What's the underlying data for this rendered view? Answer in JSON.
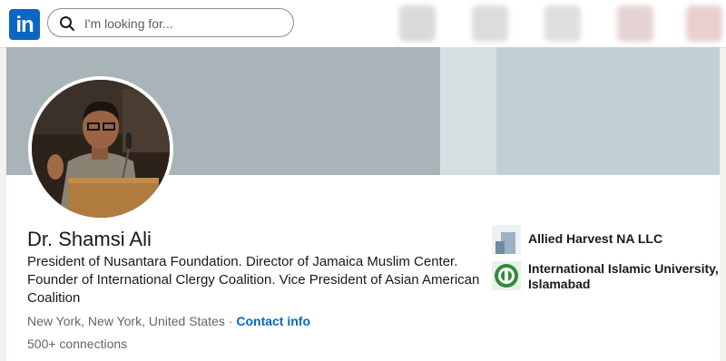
{
  "header": {
    "logo_text": "in",
    "search_placeholder": "I'm looking for..."
  },
  "profile": {
    "name": "Dr. Shamsi Ali",
    "headline": "President of Nusantara Foundation. Director of Jamaica Muslim Center. Founder of International Clergy Coalition. Vice President of Asian American Coalition",
    "location": "New York, New York, United States",
    "separator": "·",
    "contact_info_label": "Contact info",
    "connections": "500+ connections"
  },
  "experience": [
    {
      "name": "Allied Harvest NA LLC",
      "icon": "company-logo-placeholder"
    },
    {
      "name": "International Islamic University, Islamabad",
      "icon": "university-logo"
    }
  ],
  "colors": {
    "brand": "#0a66c2",
    "banner": "#a8b4b8",
    "banner_right": "#c1d0d5"
  }
}
